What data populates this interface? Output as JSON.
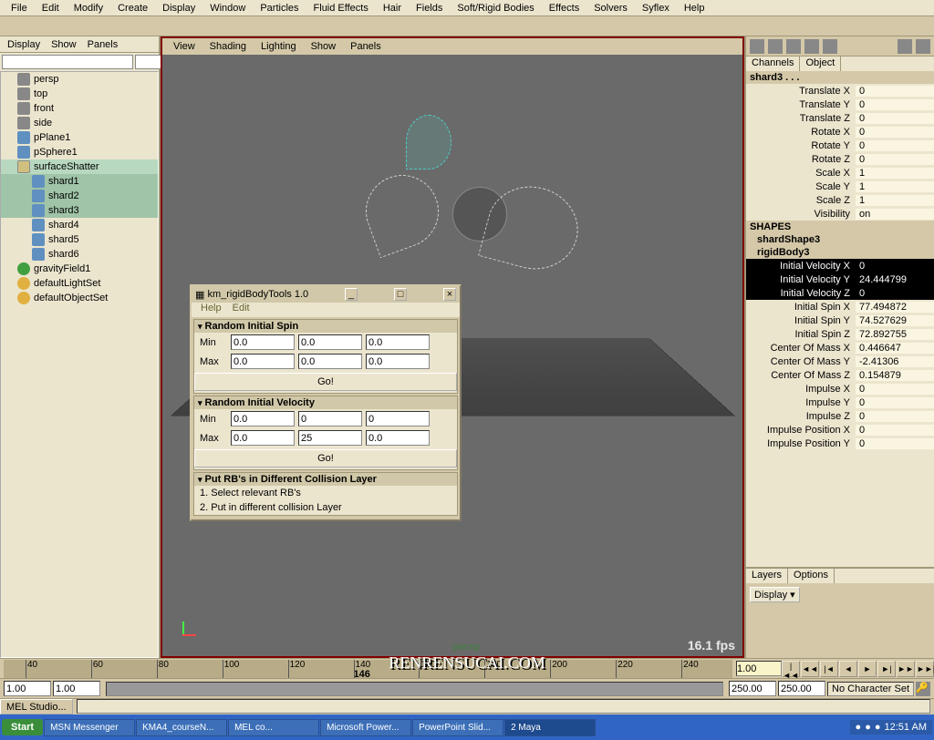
{
  "menus": [
    "File",
    "Edit",
    "Modify",
    "Create",
    "Display",
    "Window",
    "Particles",
    "Fluid Effects",
    "Hair",
    "Fields",
    "Soft/Rigid Bodies",
    "Effects",
    "Solvers",
    "Syflex",
    "Help"
  ],
  "left": {
    "tabs": [
      "Display",
      "Show",
      "Panels"
    ],
    "tree": [
      {
        "icon": "cam",
        "label": "persp"
      },
      {
        "icon": "cam",
        "label": "top"
      },
      {
        "icon": "cam",
        "label": "front"
      },
      {
        "icon": "cam",
        "label": "side"
      },
      {
        "icon": "poly",
        "label": "pPlane1"
      },
      {
        "icon": "poly",
        "label": "pSphere1"
      },
      {
        "icon": "grp",
        "label": "surfaceShatter",
        "sel": true,
        "exp": true
      },
      {
        "icon": "poly",
        "label": "shard1",
        "indent": true,
        "hl": true
      },
      {
        "icon": "poly",
        "label": "shard2",
        "indent": true,
        "hl": true
      },
      {
        "icon": "poly",
        "label": "shard3",
        "indent": true,
        "hl": true
      },
      {
        "icon": "poly",
        "label": "shard4",
        "indent": true
      },
      {
        "icon": "poly",
        "label": "shard5",
        "indent": true
      },
      {
        "icon": "poly",
        "label": "shard6",
        "indent": true
      },
      {
        "icon": "fld",
        "label": "gravityField1"
      },
      {
        "icon": "set",
        "label": "defaultLightSet"
      },
      {
        "icon": "set",
        "label": "defaultObjectSet"
      }
    ]
  },
  "view": {
    "menus": [
      "View",
      "Shading",
      "Lighting",
      "Show",
      "Panels"
    ],
    "camera": "persp",
    "fps": "16.1 fps"
  },
  "right": {
    "tabs": [
      "Channels",
      "Object"
    ],
    "selected": "shard3 . . .",
    "channels": [
      {
        "label": "Translate X",
        "val": "0"
      },
      {
        "label": "Translate Y",
        "val": "0"
      },
      {
        "label": "Translate Z",
        "val": "0"
      },
      {
        "label": "Rotate X",
        "val": "0"
      },
      {
        "label": "Rotate Y",
        "val": "0"
      },
      {
        "label": "Rotate Z",
        "val": "0"
      },
      {
        "label": "Scale X",
        "val": "1"
      },
      {
        "label": "Scale Y",
        "val": "1"
      },
      {
        "label": "Scale Z",
        "val": "1"
      },
      {
        "label": "Visibility",
        "val": "on"
      }
    ],
    "shapes_header": "SHAPES",
    "shape_name": "shardShape3",
    "rigid_name": "rigidBody3",
    "rigid": [
      {
        "label": "Initial Velocity X",
        "val": "0",
        "sel": true
      },
      {
        "label": "Initial Velocity Y",
        "val": "24.444799",
        "sel": true
      },
      {
        "label": "Initial Velocity Z",
        "val": "0",
        "sel": true
      },
      {
        "label": "Initial Spin X",
        "val": "77.494872"
      },
      {
        "label": "Initial Spin Y",
        "val": "74.527629"
      },
      {
        "label": "Initial Spin Z",
        "val": "72.892755"
      },
      {
        "label": "Center Of Mass X",
        "val": "0.446647"
      },
      {
        "label": "Center Of Mass Y",
        "val": "-2.41306"
      },
      {
        "label": "Center Of Mass Z",
        "val": "0.154879"
      },
      {
        "label": "Impulse X",
        "val": "0"
      },
      {
        "label": "Impulse Y",
        "val": "0"
      },
      {
        "label": "Impulse Z",
        "val": "0"
      },
      {
        "label": "Impulse Position X",
        "val": "0"
      },
      {
        "label": "Impulse Position Y",
        "val": "0"
      }
    ],
    "layers_tabs": [
      "Layers",
      "Options"
    ],
    "layers_display": "Display"
  },
  "timeline": {
    "ticks": [
      40,
      60,
      80,
      100,
      120,
      140,
      160,
      180,
      200,
      220,
      240
    ],
    "current": "146",
    "frame_field": "1.00",
    "start": "1.00",
    "end": "1.00",
    "range_start": "250.00",
    "range_end": "250.00",
    "charset": "No Character Set"
  },
  "cmd": {
    "label": "MEL Studio..."
  },
  "dialog": {
    "title": "km_rigidBodyTools 1.0",
    "menus": [
      "Help",
      "Edit"
    ],
    "sec1": {
      "title": "Random Initial Spin",
      "min": [
        "0.0",
        "0.0",
        "0.0"
      ],
      "max": [
        "0.0",
        "0.0",
        "0.0"
      ],
      "go": "Go!"
    },
    "sec2": {
      "title": "Random Initial Velocity",
      "min": [
        "0.0",
        "0",
        "0"
      ],
      "max": [
        "0.0",
        "25",
        "0.0"
      ],
      "go": "Go!"
    },
    "sec3": {
      "title": "Put RB's in Different Collision Layer",
      "line1": "1. Select relevant RB's",
      "line2": "2. Put in different collision Layer"
    }
  },
  "taskbar": {
    "start": "Start",
    "tasks": [
      "MSN Messenger",
      "KMA4_courseN...",
      "MEL co...",
      "Microsoft Power...",
      "PowerPoint Slid...",
      "2 Maya"
    ],
    "time": "12:51 AM"
  },
  "watermark": "RENRENSUCAI.COM"
}
